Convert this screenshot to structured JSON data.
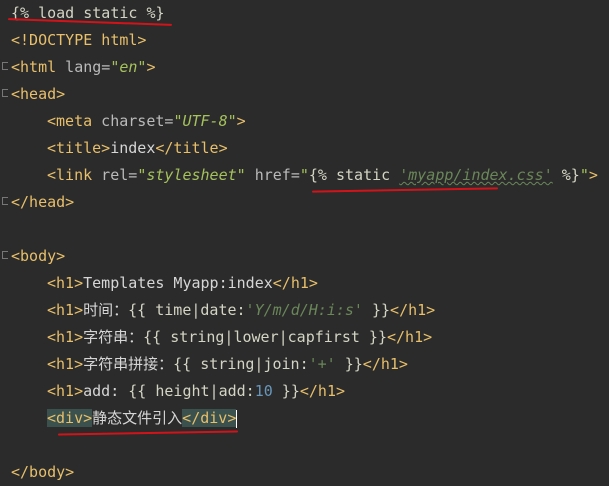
{
  "lines": [
    {
      "id": "l1",
      "text": "{% load static %}"
    },
    {
      "id": "l2",
      "text": "<!DOCTYPE html>"
    },
    {
      "id": "l3",
      "tag_open": "<html",
      "attr": " lang=",
      "val": "\"en\"",
      "tag_close": ">"
    },
    {
      "id": "l4",
      "text": "<head>"
    },
    {
      "id": "l5",
      "tag_open": "<meta",
      "attr": " charset=",
      "val": "\"UTF-8\"",
      "tag_close": ">"
    },
    {
      "id": "l6",
      "tag_a": "<title>",
      "text": "index",
      "tag_b": "</title>"
    },
    {
      "id": "l7",
      "tag_open": "<link",
      "attr1": " rel=",
      "val1": "\"stylesheet\"",
      "attr2": " href=",
      "q": "\"",
      "tpl_open": "{% static ",
      "str": "'myapp/index.css'",
      "tpl_close": " %}",
      "q2": "\"",
      "tag_close": ">"
    },
    {
      "id": "l8",
      "text": "</head>"
    },
    {
      "id": "l10",
      "text": "<body>"
    },
    {
      "id": "l11",
      "tag_a": "<h1>",
      "text": "Templates Myapp:index",
      "tag_b": "</h1>"
    },
    {
      "id": "l12",
      "tag_a": "<h1>",
      "cjk": "时间：",
      "tpl1": "{{ time|date:",
      "str": "'Y/m/d/H:i:s'",
      "tpl2": " }}",
      "tag_b": "</h1>"
    },
    {
      "id": "l13",
      "tag_a": "<h1>",
      "cjk": "字符串：",
      "tpl": "{{ string|lower|capfirst }}",
      "tag_b": "</h1>"
    },
    {
      "id": "l14",
      "tag_a": "<h1>",
      "cjk": "字符串拼接：",
      "tpl1": "{{ string|join:",
      "str": "'+'",
      "tpl2": " }}",
      "tag_b": "</h1>"
    },
    {
      "id": "l15",
      "tag_a": "<h1>",
      "plain": "add: ",
      "tpl1": "{{ height|add:",
      "num": "10",
      "tpl2": " }}",
      "tag_b": "</h1>"
    },
    {
      "id": "l16",
      "tag_a": "<div>",
      "cjk": "静态文件引入",
      "tag_b": "</div>"
    },
    {
      "id": "l17",
      "text": "</body>"
    }
  ]
}
